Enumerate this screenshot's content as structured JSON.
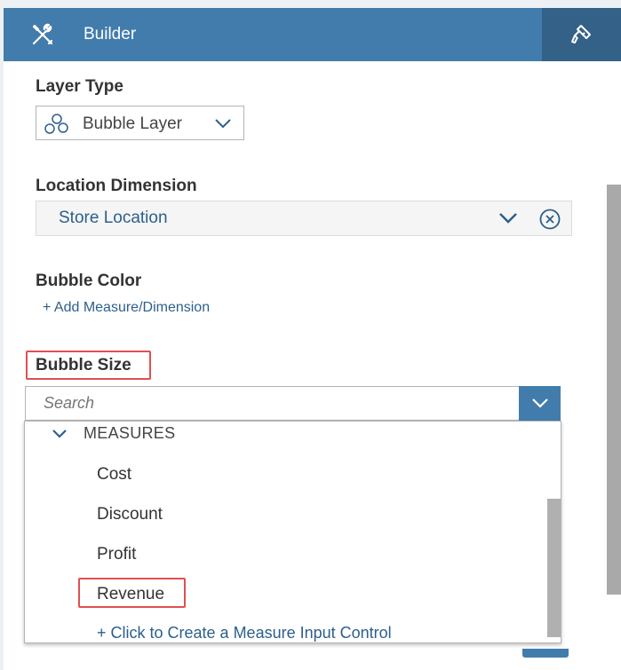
{
  "header": {
    "title": "Builder",
    "tools_icon": "tools-icon",
    "styling_icon": "paint-brush-icon"
  },
  "layer_type": {
    "label": "Layer Type",
    "value": "Bubble Layer",
    "icon": "bubble-icon"
  },
  "location_dimension": {
    "label": "Location Dimension",
    "value": "Store Location"
  },
  "bubble_color": {
    "label": "Bubble Color",
    "add_link": "+ Add Measure/Dimension"
  },
  "bubble_size": {
    "label": "Bubble Size",
    "search_placeholder": "Search",
    "group": "MEASURES",
    "items": [
      "Cost",
      "Discount",
      "Profit",
      "Revenue"
    ],
    "selected_item": "Revenue",
    "create_link": "+ Click to Create a Measure Input Control"
  },
  "colors": {
    "header_bg": "#427cac",
    "header_active_tab": "#346187",
    "link": "#2c5f8c",
    "highlight": "#e05050"
  }
}
